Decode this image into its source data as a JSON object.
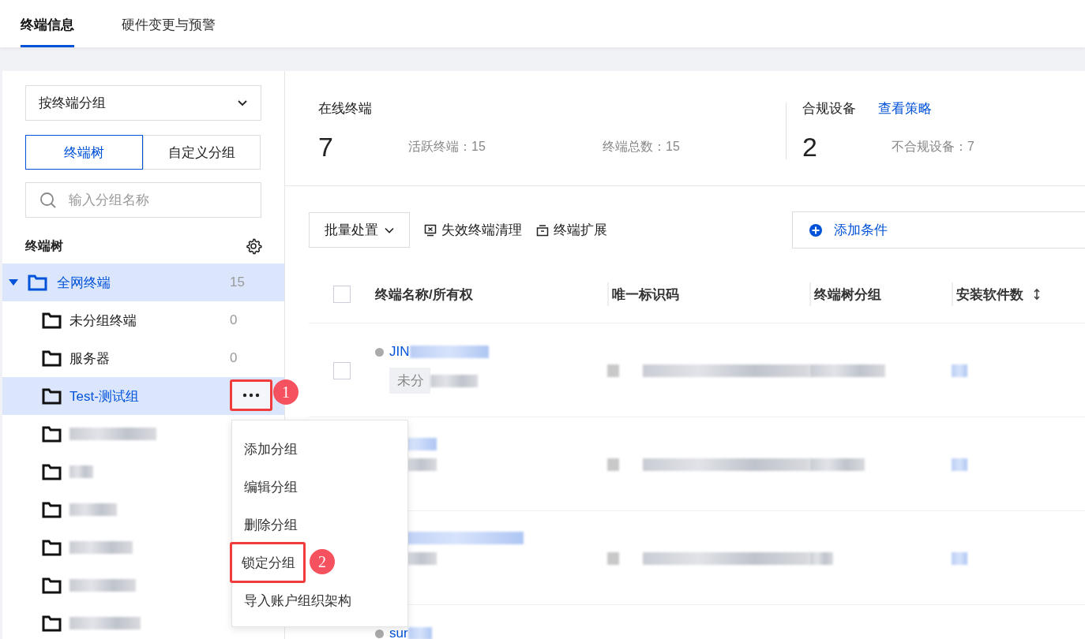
{
  "tabs": [
    {
      "label": "终端信息",
      "selected": true
    },
    {
      "label": "硬件变更与预警",
      "selected": false
    }
  ],
  "sidebar": {
    "group_by": "按终端分组",
    "view_tabs": [
      {
        "label": "终端树",
        "selected": true
      },
      {
        "label": "自定义分组",
        "selected": false
      }
    ],
    "search": {
      "placeholder": "输入分组名称"
    },
    "tree_title": "终端树",
    "tree": [
      {
        "kind": "folder",
        "label": "全网终端",
        "count": "15",
        "expanded": true,
        "selected": true,
        "children": [
          {
            "kind": "folder",
            "label": "未分组终端",
            "count": "0",
            "selected": false
          },
          {
            "kind": "folder",
            "label": "服务器",
            "count": "0",
            "selected": false
          },
          {
            "kind": "folder",
            "label": "Test-测试组",
            "selected": true,
            "more_menu": true
          },
          {
            "kind": "blurred",
            "selected": false
          },
          {
            "kind": "blurred",
            "selected": false
          },
          {
            "kind": "blurred",
            "selected": false
          },
          {
            "kind": "blurred",
            "selected": false
          },
          {
            "kind": "blurred",
            "selected": false
          },
          {
            "kind": "blurred",
            "selected": false
          }
        ]
      }
    ]
  },
  "context_menu": {
    "items": [
      {
        "label": "添加分组",
        "annotated": false
      },
      {
        "label": "编辑分组",
        "annotated": false
      },
      {
        "label": "删除分组",
        "annotated": false
      },
      {
        "label": "锁定分组",
        "annotated": true
      },
      {
        "label": "导入账户组织架构",
        "annotated": false
      }
    ]
  },
  "annotations": [
    "1",
    "2"
  ],
  "stats": {
    "online": {
      "label": "在线终端",
      "value": "7",
      "details": [
        "活跃终端：15",
        "终端总数：15"
      ]
    },
    "compliance": {
      "label": "合规设备",
      "link": "查看策略",
      "value": "2",
      "detail": "不合规设备：7"
    }
  },
  "toolbar": {
    "batch": "批量处置",
    "actions": [
      {
        "kind": "clean",
        "label": "失效终端清理"
      },
      {
        "kind": "extend",
        "label": "终端扩展"
      }
    ],
    "add_condition": "添加条件"
  },
  "table": {
    "columns": [
      {
        "label": "终端名称/所有权",
        "sortable": false
      },
      {
        "label": "唯一标识码",
        "sortable": false
      },
      {
        "label": "终端树分组",
        "sortable": false
      },
      {
        "label": "安装软件数",
        "sortable": true
      }
    ],
    "header_checked": false,
    "rows": [
      {
        "name": "JIN",
        "tag": "未分",
        "checked": false
      },
      {},
      {},
      {
        "name": "sur"
      }
    ]
  }
}
